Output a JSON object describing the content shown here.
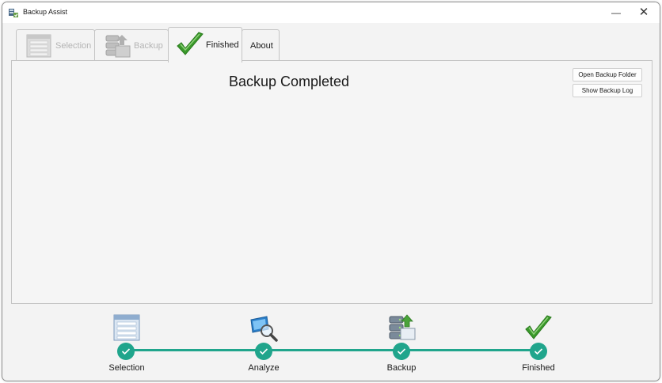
{
  "window": {
    "title": "Backup Assist",
    "minimize_glyph": "—",
    "close_glyph": "✕"
  },
  "tabs": [
    {
      "label": "Selection",
      "state": "disabled",
      "icon": "list-icon"
    },
    {
      "label": "Backup",
      "state": "disabled",
      "icon": "server-backup-icon"
    },
    {
      "label": "Finished",
      "state": "active",
      "icon": "checkmark-icon"
    },
    {
      "label": "About",
      "state": "normal"
    }
  ],
  "panel": {
    "heading": "Backup Completed",
    "open_folder_label": "Open Backup Folder",
    "show_log_label": "Show Backup Log"
  },
  "steps": [
    {
      "label": "Selection",
      "icon": "list-icon",
      "completed": true
    },
    {
      "label": "Analyze",
      "icon": "magnifier-icon",
      "completed": true
    },
    {
      "label": "Backup",
      "icon": "server-backup-icon",
      "completed": true
    },
    {
      "label": "Finished",
      "icon": "checkmark-icon",
      "completed": true
    }
  ],
  "colors": {
    "accent": "#20a58c",
    "check_green": "#3a9a2a"
  }
}
